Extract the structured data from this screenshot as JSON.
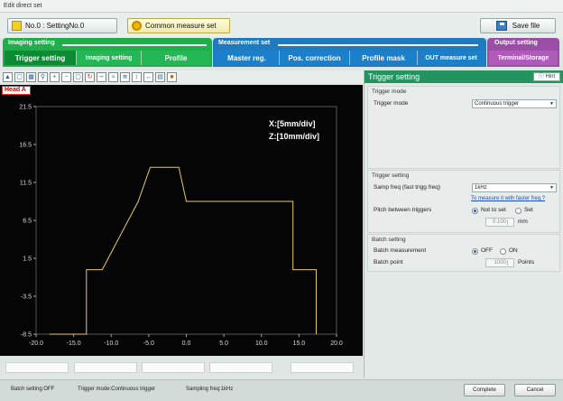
{
  "window": {
    "title": "Edit direct set"
  },
  "topbar": {
    "setting_label": "No.0 : SettingNo.0",
    "common_label": "Common measure set",
    "save_label": "Save file"
  },
  "groups": {
    "imaging": "Imaging setting",
    "measurement": "Measurement set",
    "output": "Output setting"
  },
  "tabs": {
    "trigger": "Trigger setting",
    "imaging": "Imaging setting",
    "profile": "Profile",
    "master": "Master reg.",
    "position": "Pos. correction",
    "mask": "Profile mask",
    "out_measure": "OUT measure set",
    "terminal": "Terminal/Storage"
  },
  "head_tag": "Head A",
  "chart_data": {
    "type": "line",
    "x_ticks": [
      "-20.0",
      "-15.0",
      "-10.0",
      "-5.0",
      "0.0",
      "5.0",
      "10.0",
      "15.0",
      "20.0"
    ],
    "y_ticks": [
      "21.5",
      "16.5",
      "11.5",
      "6.5",
      "1.5",
      "-3.5",
      "-8.5"
    ],
    "xlim": [
      -20,
      20
    ],
    "ylim": [
      -8.5,
      21.5
    ],
    "x_scale_label": "X:[5mm/div]",
    "z_scale_label": "Z:[10mm/div]",
    "series": [
      {
        "color": "#e6c86a",
        "x": [
          -18.2,
          -13.3,
          -13.3,
          -11.2,
          -6.4,
          -4.8,
          -1.0,
          0.0,
          1.4,
          6.5,
          11.5,
          14.2,
          14.2,
          17.3,
          17.3
        ],
        "y": [
          -8.5,
          -8.5,
          0.0,
          0.0,
          9.0,
          13.5,
          13.5,
          9.0,
          9.0,
          9.0,
          9.0,
          9.0,
          0.0,
          0.0,
          -8.5
        ]
      }
    ]
  },
  "panel": {
    "title": "Trigger setting",
    "hint": "Hint",
    "trigger_mode_section": "Trigger mode",
    "trigger_mode_label": "Trigger mode",
    "trigger_mode_value": "Continuous trigger",
    "trigger_setting_section": "Trigger setting",
    "samp_freq_label": "Samp freq (fast trigg freq)",
    "samp_freq_value": "1kHz",
    "faster_link": "To measure it with faster freq.?",
    "pitch_label": "Pitch between triggers",
    "pitch_not_set": "Not to set",
    "pitch_set": "Set",
    "pitch_value": "0.100",
    "pitch_unit": "mm",
    "batch_section": "Batch setting",
    "batch_measurement_label": "Batch measurement",
    "batch_off": "OFF",
    "batch_on": "ON",
    "batch_point_label": "Batch point",
    "batch_point_value": "1000",
    "batch_point_unit": "Points"
  },
  "status": {
    "batch": "Batch setting:OFF",
    "trigger": "Trigger mode:Continuous trigger",
    "sampling": "Sampling freq:1kHz",
    "complete": "Complete",
    "cancel": "Cancel"
  }
}
